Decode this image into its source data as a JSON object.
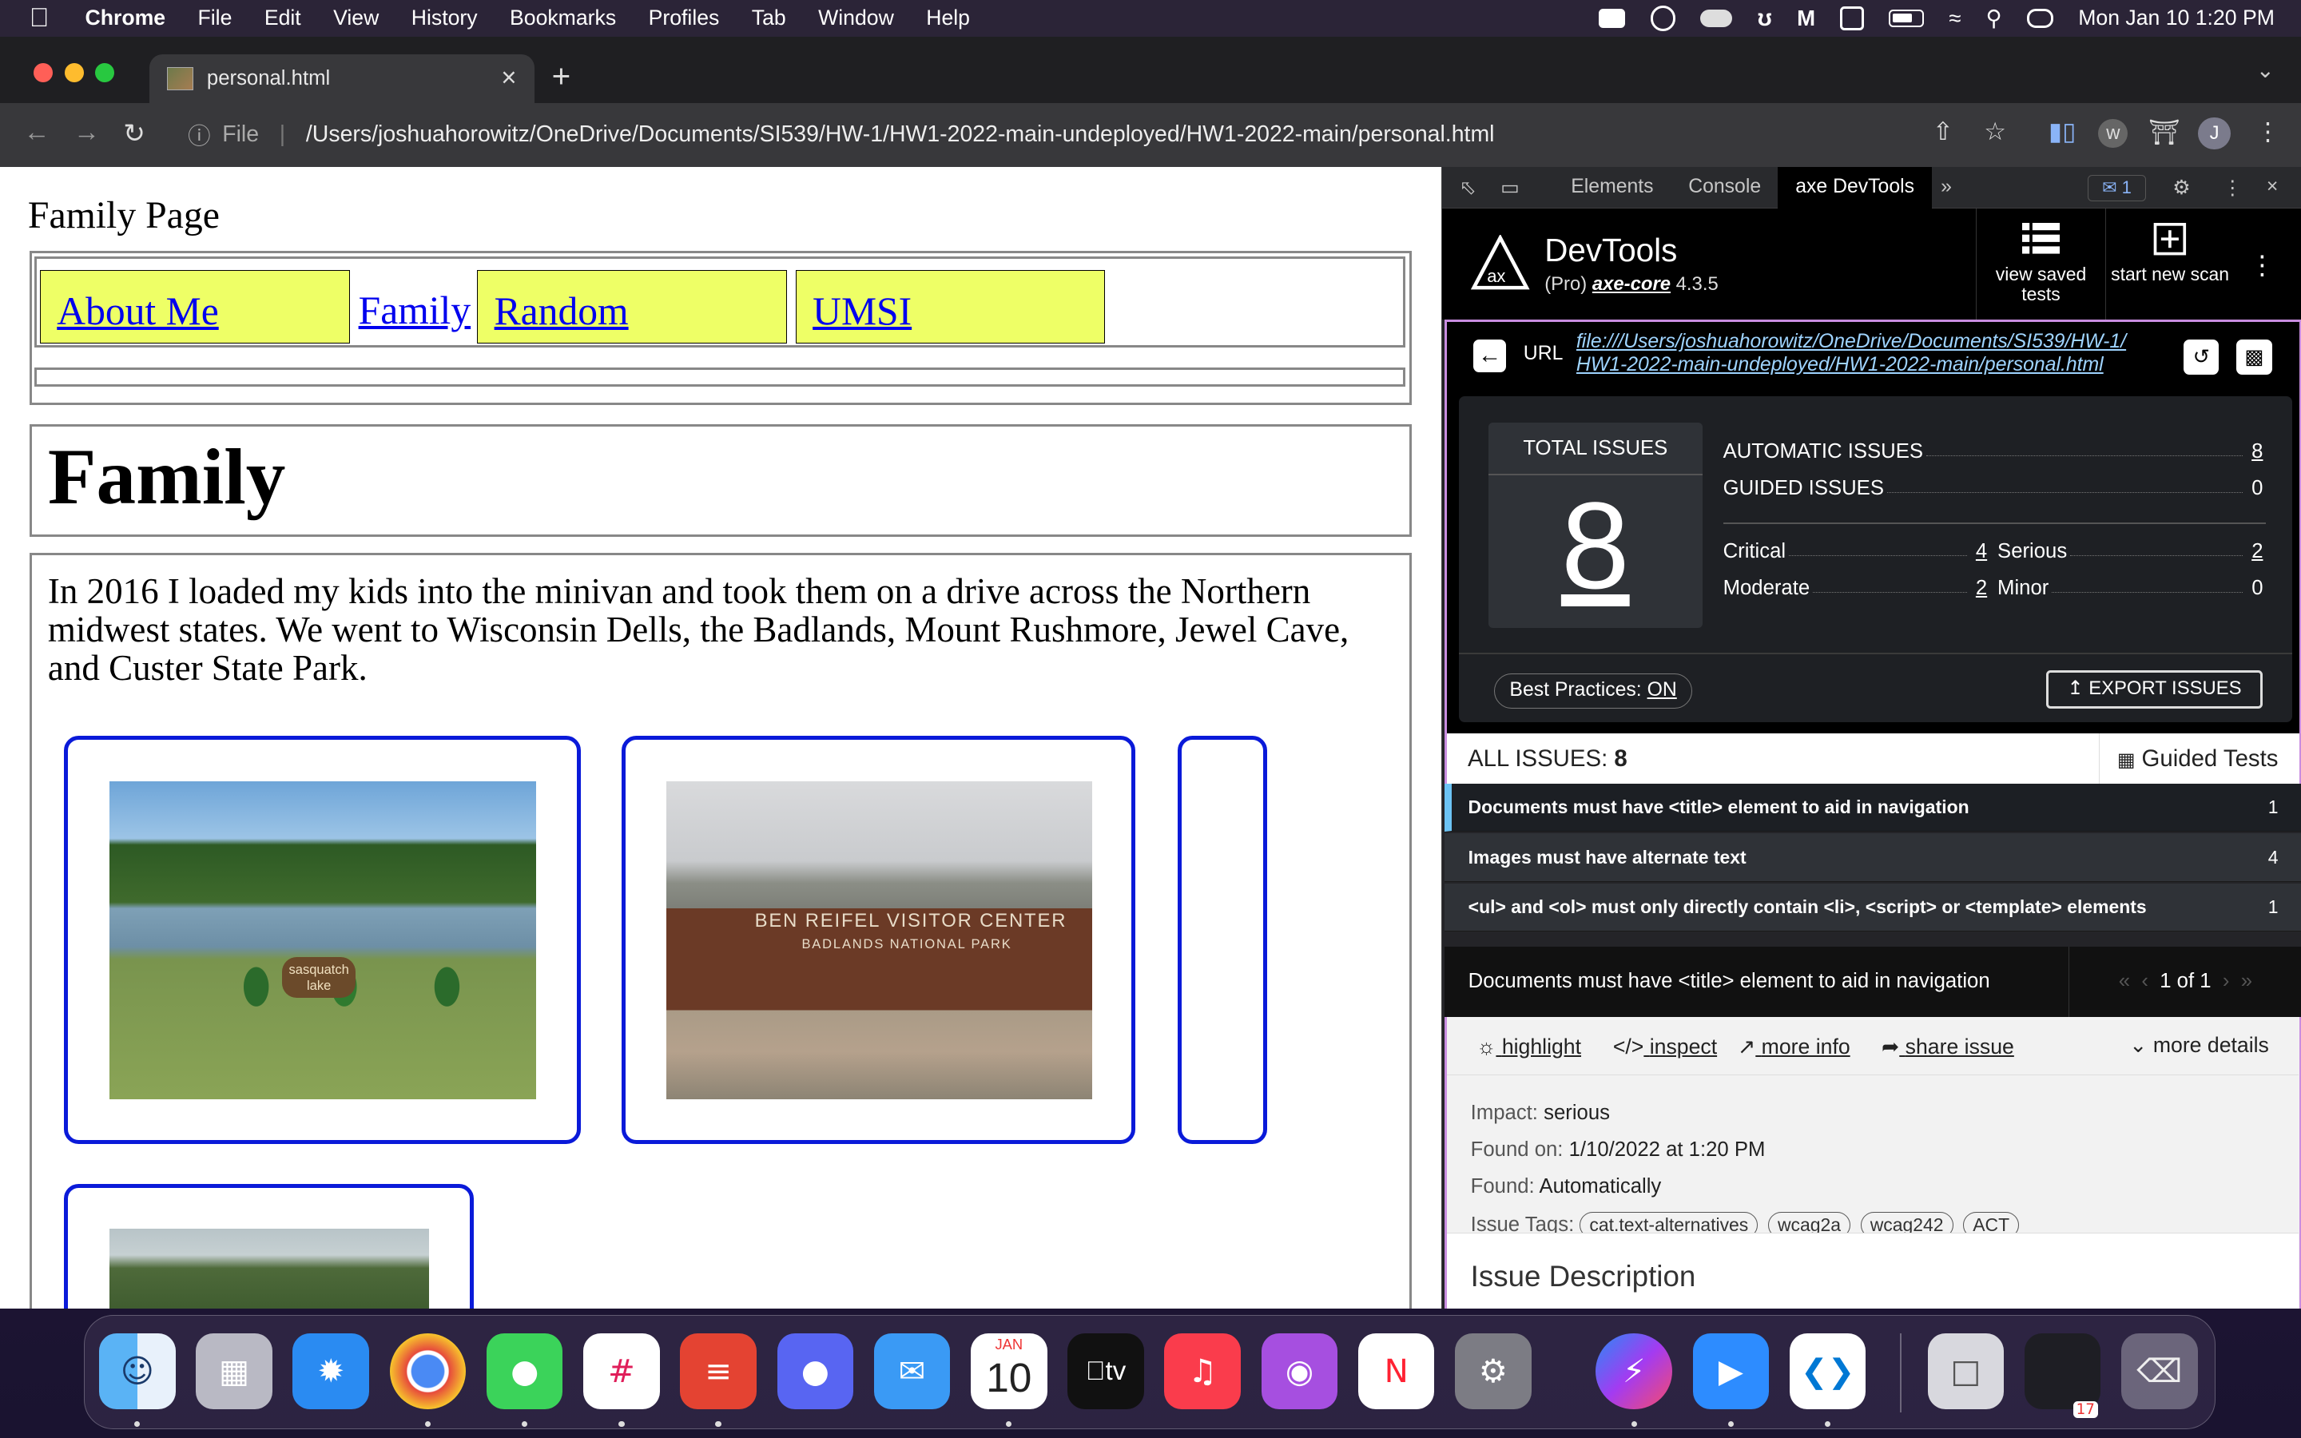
{
  "menubar": {
    "app": "Chrome",
    "items": [
      "File",
      "Edit",
      "View",
      "History",
      "Bookmarks",
      "Profiles",
      "Tab",
      "Window",
      "Help"
    ],
    "clock": "Mon Jan 10  1:20 PM"
  },
  "browser": {
    "tab_title": "personal.html",
    "address_scheme": "File",
    "address": "/Users/joshuahorowitz/OneDrive/Documents/SI539/HW-1/HW1-2022-main-undeployed/HW1-2022-main/personal.html",
    "profile_initial": "J"
  },
  "page": {
    "site_title": "Family Page",
    "nav": [
      "About Me",
      "Family",
      "Random",
      "UMSI"
    ],
    "heading": "Family",
    "paragraph": "In 2016 I loaded my kids into the minivan and took them on a drive across the Northern midwest states. We went to Wisconsin Dells, the Badlands, Mount Rushmore, Jewel Cave, and Custer State Park.",
    "photo1_sign": "sasquatch lake",
    "photo2_sign_line1": "BEN REIFEL VISITOR CENTER",
    "photo2_sign_line2": "BADLANDS NATIONAL PARK"
  },
  "devtools": {
    "tabs": [
      "Elements",
      "Console",
      "axe DevTools"
    ],
    "active_tab": "axe DevTools",
    "message_count": "1",
    "axe_title": "DevTools",
    "axe_subtitle_pre": "(Pro)",
    "axe_core": "axe-core",
    "axe_version": "4.3.5",
    "btn_saved": "view saved tests",
    "btn_new": "start new scan",
    "url_label": "URL",
    "url_line1": "file:///Users/joshuahorowitz/OneDrive/Documents/SI539/HW-1/",
    "url_line2": "HW1-2022-main-undeployed/HW1-2022-main/personal.html",
    "total_label": "TOTAL ISSUES",
    "total": "8",
    "automatic_label": "AUTOMATIC ISSUES",
    "automatic": "8",
    "guided_label": "GUIDED ISSUES",
    "guided": "0",
    "critical_label": "Critical",
    "critical": "4",
    "serious_label": "Serious",
    "serious": "2",
    "moderate_label": "Moderate",
    "moderate": "2",
    "minor_label": "Minor",
    "minor": "0",
    "best_practices_label": "Best Practices:",
    "best_practices_value": "ON",
    "export_label": "EXPORT ISSUES",
    "all_issues_label": "ALL ISSUES:",
    "all_issues_count": "8",
    "guided_tests_label": "Guided Tests",
    "issues": [
      {
        "text": "Documents must have <title> element to aid in navigation",
        "count": "1"
      },
      {
        "text": "Images must have alternate text",
        "count": "4"
      },
      {
        "text": "<ul> and <ol> must only directly contain <li>, <script> or <template> elements",
        "count": "1"
      }
    ],
    "detail_title": "Documents must have <title> element to aid in navigation",
    "pager": "1 of 1",
    "actions": [
      "highlight",
      "inspect",
      "more info",
      "share issue"
    ],
    "more_details": "more details",
    "impact_label": "Impact:",
    "impact": "serious",
    "found_on_label": "Found on:",
    "found_on": "1/10/2022 at 1:20 PM",
    "found_label": "Found:",
    "found": "Automatically",
    "tags_label": "Issue Tags:",
    "tags": [
      "cat.text-alternatives",
      "wcag2a",
      "wcag242",
      "ACT"
    ],
    "description_heading": "Issue Description"
  },
  "dock": {
    "calendar_month": "JAN",
    "calendar_day": "10",
    "tv_label": "tv",
    "badge": "17"
  }
}
